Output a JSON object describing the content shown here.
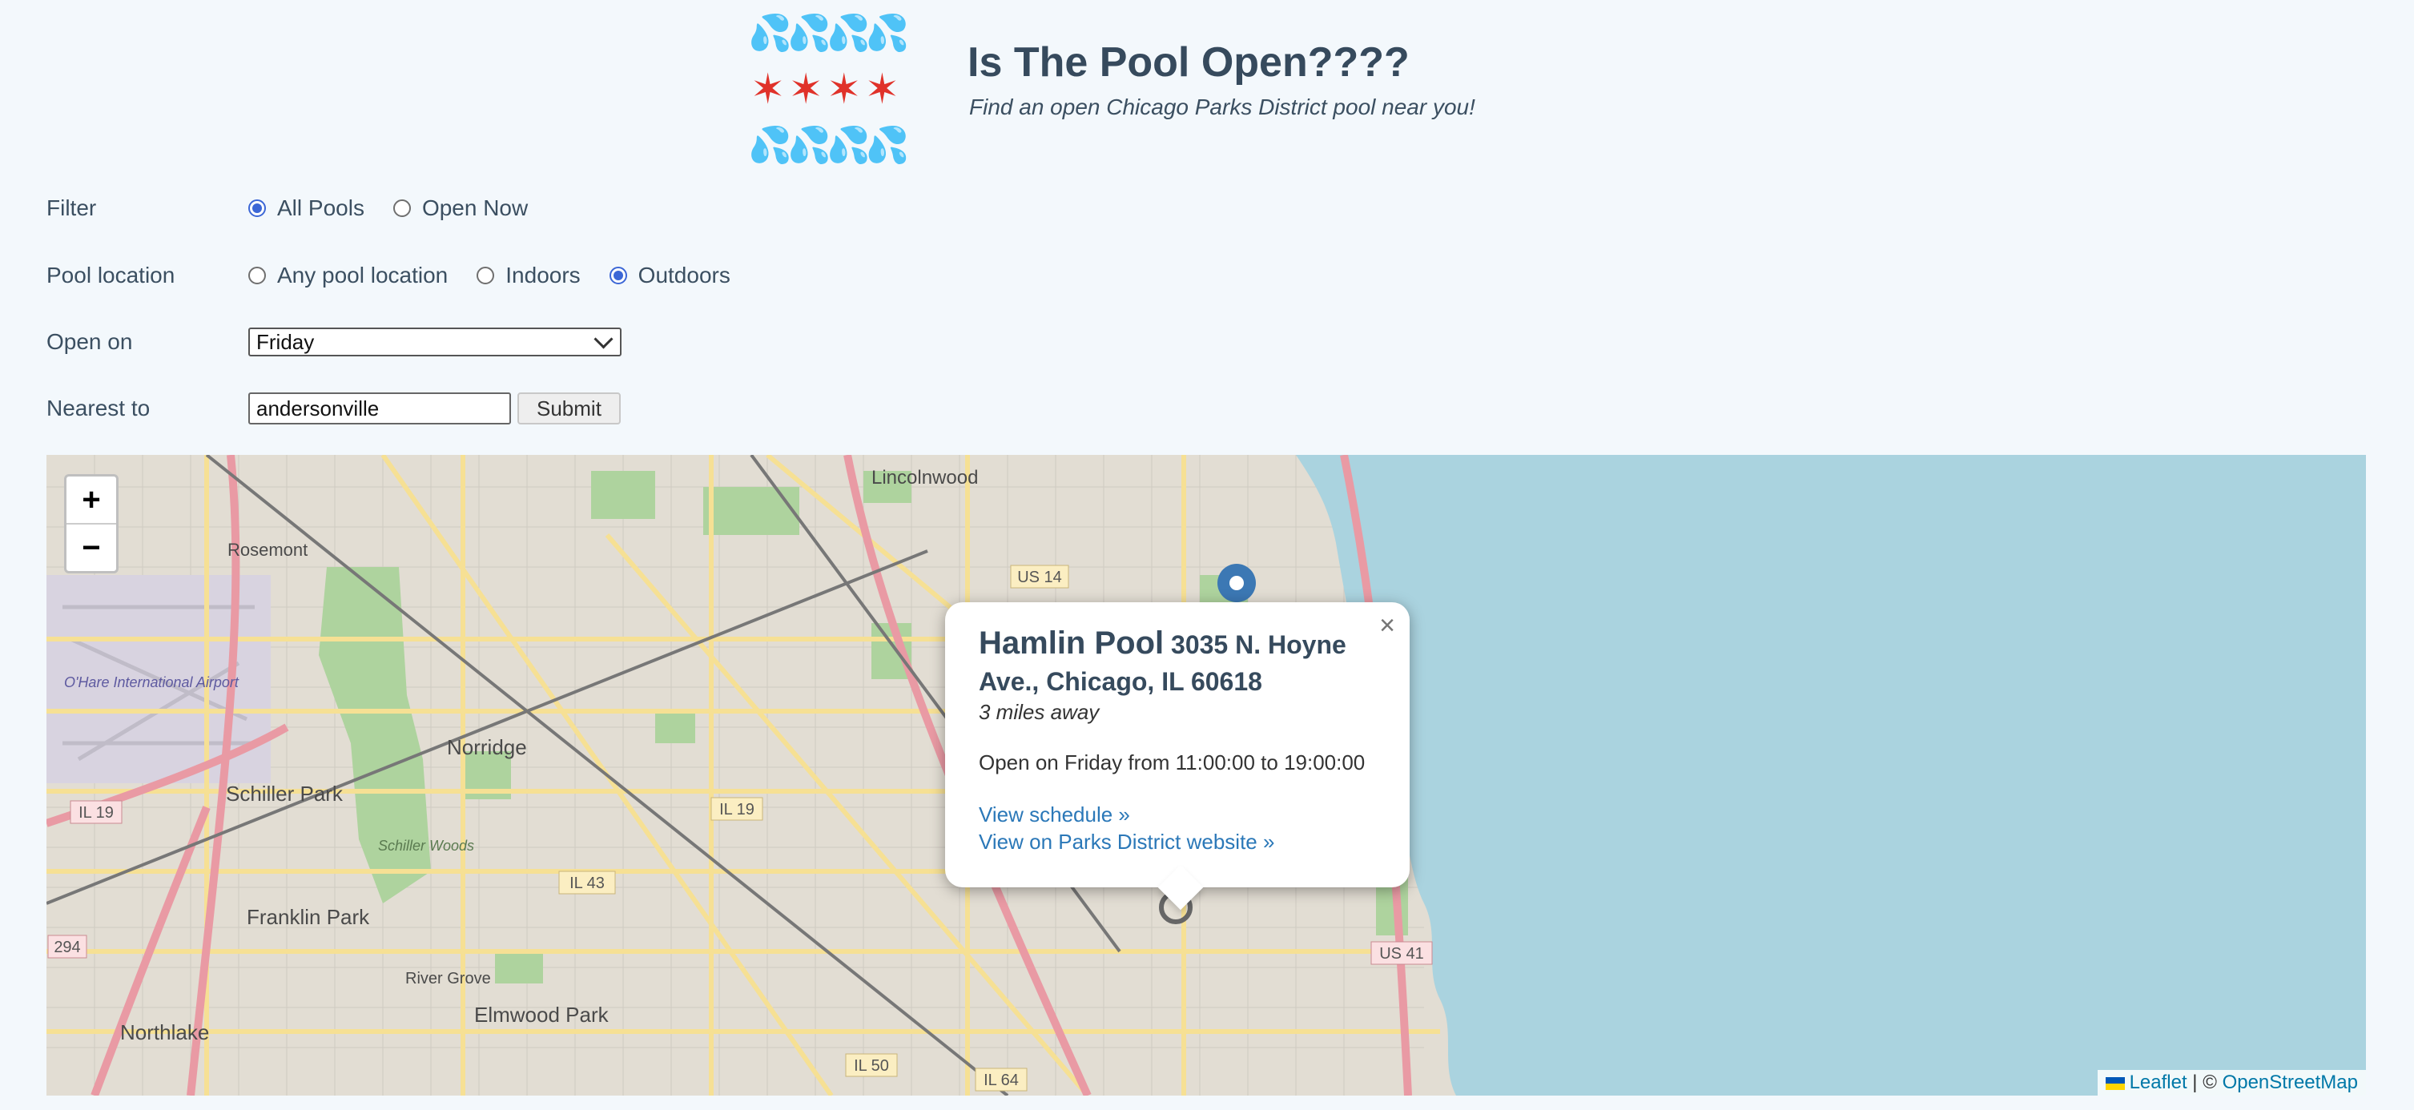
{
  "header": {
    "logo_top": "💦💦💦💦",
    "logo_stars": "✶✶✶✶",
    "logo_bottom": "💦💦💦💦",
    "title": "Is The Pool Open????",
    "subtitle": "Find an open Chicago Parks District pool near you!"
  },
  "form": {
    "filter": {
      "label": "Filter",
      "options": [
        "All Pools",
        "Open Now"
      ],
      "selected": "All Pools"
    },
    "location": {
      "label": "Pool location",
      "options": [
        "Any pool location",
        "Indoors",
        "Outdoors"
      ],
      "selected": "Outdoors"
    },
    "open_on": {
      "label": "Open on",
      "value": "Friday"
    },
    "nearest": {
      "label": "Nearest to",
      "value": "andersonville",
      "submit": "Submit"
    }
  },
  "map": {
    "zoom_in": "+",
    "zoom_out": "−",
    "places": [
      "Lincolnwood",
      "Rosemont",
      "O'Hare International Airport",
      "Norridge",
      "Schiller Park",
      "Schiller Woods",
      "Franklin Park",
      "River Grove",
      "Elmwood Park",
      "Northlake"
    ],
    "road_labels": [
      "US 14",
      "IL 19",
      "IL 19",
      "IL 43",
      "294",
      "IL 50",
      "IL 64",
      "US 41"
    ],
    "attribution": {
      "leaflet": "Leaflet",
      "separator": "| ©",
      "osm": "OpenStreetMap"
    },
    "colors": {
      "water": "#aad3df",
      "land": "#e2ddd3",
      "park": "#aed39e",
      "major_road": "#f6e094",
      "highway": "#e99aa4",
      "marker": "#3c78b4"
    }
  },
  "popup": {
    "name": "Hamlin Pool",
    "address": "3035 N. Hoyne Ave., Chicago, IL 60618",
    "distance": "3 miles away",
    "hours": "Open on Friday from 11:00:00 to 19:00:00",
    "schedule_link": "View schedule »",
    "parks_link": "View on Parks District website »",
    "close": "×"
  }
}
